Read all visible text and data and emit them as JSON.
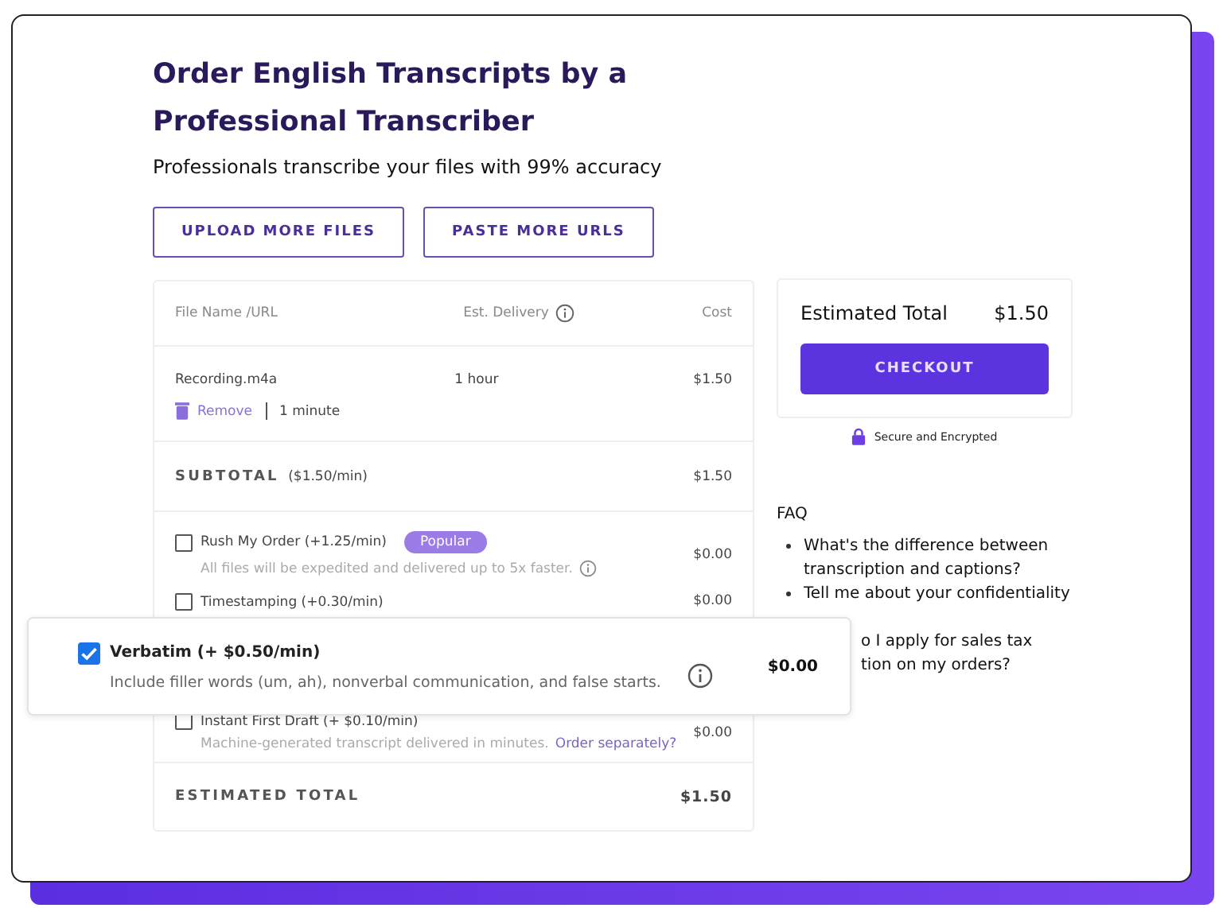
{
  "title": "Order English Transcripts by a Professional Transcriber",
  "subtitle": "Professionals transcribe your files with 99% accuracy",
  "actions": [
    "UPLOAD MORE FILES",
    "PASTE MORE URLS"
  ],
  "table": {
    "columns": [
      "File Name /URL",
      "Est. Delivery",
      "Cost"
    ],
    "files": [
      {
        "name": "Recording.m4a",
        "delivery": "1 hour",
        "cost": "$1.50",
        "remove": "Remove",
        "duration": "1 minute"
      }
    ],
    "subtotal": {
      "label": "SUBTOTAL",
      "rate": "($1.50/min)",
      "cost": "$1.50"
    },
    "options": [
      {
        "label": "Rush My Order (+1.25/min)",
        "checked": false,
        "badge": "Popular",
        "description": "All files will be expedited and delivered up to 5x faster.",
        "info": true,
        "cost": "$0.00"
      },
      {
        "label": "Timestamping (+0.30/min)",
        "checked": false,
        "cost": "$0.00",
        "covered": true
      },
      {
        "label": "Instant First Draft (+ $0.10/min)",
        "checked": false,
        "description": "Machine-generated transcript delivered in minutes.",
        "link": "Order separately?",
        "cost": "$0.00"
      }
    ],
    "total": {
      "label": "ESTIMATED TOTAL",
      "cost": "$1.50"
    }
  },
  "summary": {
    "label": "Estimated Total",
    "amount": "$1.50",
    "button": "CHECKOUT",
    "secure": "Secure and Encrypted"
  },
  "faq": {
    "heading": "FAQ",
    "items": [
      {
        "kind": "bullet",
        "lines": [
          "What's the difference between",
          "transcription and captions?"
        ]
      },
      {
        "kind": "bullet",
        "lines": [
          "Tell me about your confidentiality"
        ]
      },
      {
        "kind": "partial",
        "lines": [
          "o I apply for sales tax",
          "tion on my orders?"
        ]
      }
    ]
  },
  "popup": {
    "label": "Verbatim (+ $0.50/min)",
    "checked": true,
    "description": "Include filler words (um, ah), nonverbal communication, and false starts.",
    "cost": "$0.00"
  }
}
